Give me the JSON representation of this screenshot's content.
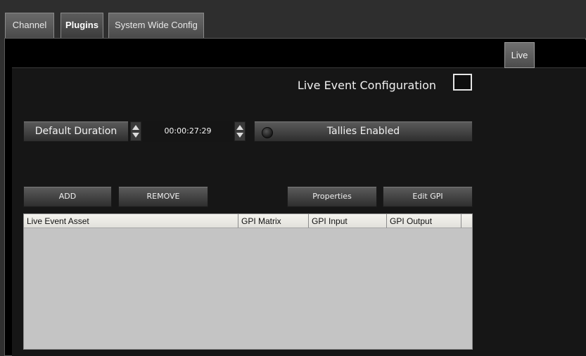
{
  "tabs": [
    {
      "label": "Channel"
    },
    {
      "label": "Plugins"
    },
    {
      "label": "System Wide Config"
    }
  ],
  "subtab": {
    "label": "Live"
  },
  "config": {
    "title": "Live Event Configuration",
    "checkbox_checked": false
  },
  "duration": {
    "label": "Default Duration",
    "value": "00:00:27:29"
  },
  "tallies": {
    "label": "Tallies Enabled",
    "led_on": false
  },
  "buttons": {
    "add": "ADD",
    "remove": "REMOVE",
    "properties": "Properties",
    "edit_gpi": "Edit GPI"
  },
  "table": {
    "columns": [
      "Live Event Asset",
      "GPI Matrix",
      "GPI Input",
      "GPI Output"
    ],
    "rows": []
  }
}
